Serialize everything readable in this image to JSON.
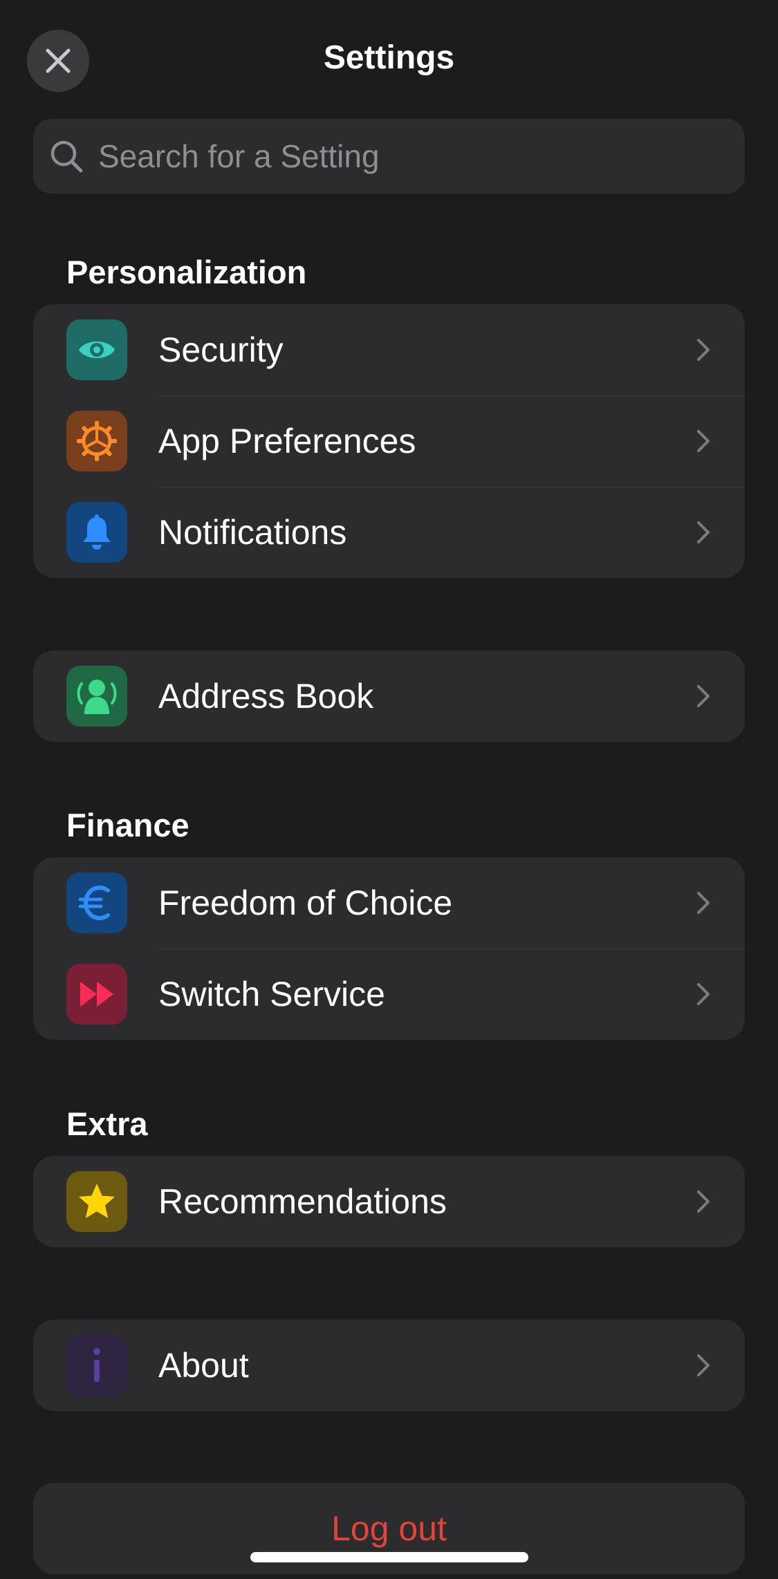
{
  "header": {
    "title": "Settings"
  },
  "search": {
    "placeholder": "Search for a Setting",
    "value": ""
  },
  "sections": {
    "personalization": "Personalization",
    "finance": "Finance",
    "extra": "Extra"
  },
  "personalization": [
    {
      "label": "Security",
      "icon": "eye-icon",
      "tile_color": "#1f6b66",
      "icon_color": "#3ad1c1"
    },
    {
      "label": "App Preferences",
      "icon": "gear-icon",
      "tile_color": "#7a3f1d",
      "icon_color": "#ff8a2a"
    },
    {
      "label": "Notifications",
      "icon": "bell-icon",
      "tile_color": "#13457f",
      "icon_color": "#2f8dff"
    }
  ],
  "address": [
    {
      "label": "Address Book",
      "icon": "contacts-icon",
      "tile_color": "#1f6a45",
      "icon_color": "#3fd98a"
    }
  ],
  "finance": [
    {
      "label": "Freedom of Choice",
      "icon": "euro-icon",
      "tile_color": "#13457f",
      "icon_color": "#2f8dff"
    },
    {
      "label": "Switch Service",
      "icon": "fast-forward-icon",
      "tile_color": "#7a1f35",
      "icon_color": "#ff2d55"
    }
  ],
  "extra": [
    {
      "label": "Recommendations",
      "icon": "star-icon",
      "tile_color": "#6b5a10",
      "icon_color": "#ffd60a"
    }
  ],
  "about": [
    {
      "label": "About",
      "icon": "info-icon",
      "tile_color": "#2e2543",
      "icon_color": "#5a3fa0"
    }
  ],
  "logout": {
    "label": "Log out",
    "color": "#e0443a"
  }
}
